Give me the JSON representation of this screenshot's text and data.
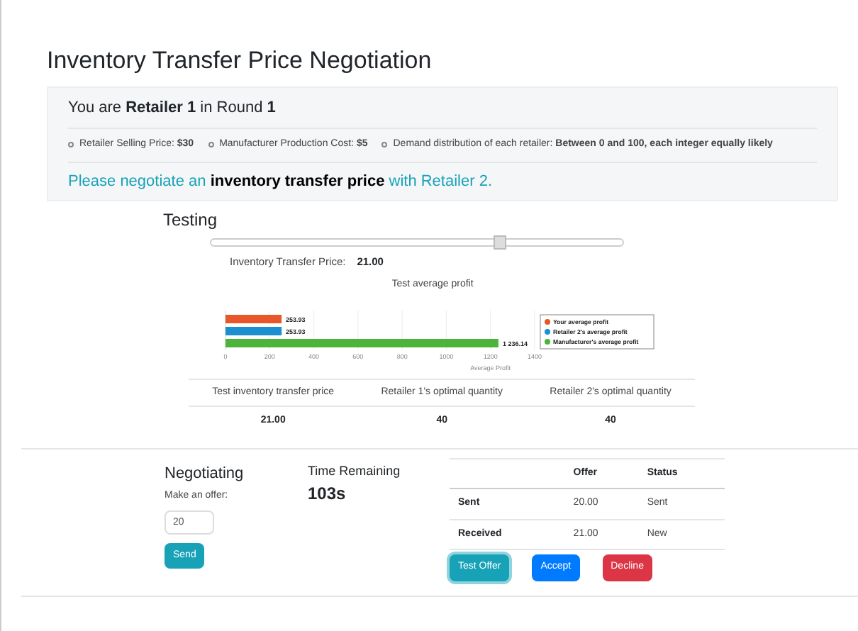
{
  "title": "Inventory Transfer Price Negotiation",
  "info": {
    "role_line": "You are **Retailer 1** in Round **1**",
    "facts": [
      "Retailer Selling Price: **$30**",
      "Manufacturer Production Cost: **$5**",
      "Demand distribution of each retailer: **Between 0 and 100, each integer equally likely**"
    ],
    "instruction": "Please negotiate an **inventory transfer price** with Retailer 2."
  },
  "testing": {
    "heading": "Testing",
    "slider": {
      "level": 0.7
    },
    "price_label": "Inventory Transfer Price:",
    "price_value": "21.00",
    "chart_data": {
      "type": "bar",
      "orientation": "horizontal",
      "title": "Test average profit",
      "xlabel": "Average Profit",
      "xlim": [
        0,
        1400
      ],
      "xticks": [
        0,
        200,
        400,
        600,
        800,
        1000,
        1200,
        1400
      ],
      "grid": true,
      "legend": "right",
      "series": [
        {
          "name": "Your average profit",
          "color": "#e8572a",
          "values": [
            254
          ]
        },
        {
          "name": "Retailer 2's average profit",
          "color": "#1b8fd0",
          "values": [
            254
          ]
        },
        {
          "name": "Manufacturer's average profit",
          "color": "#4cb43a",
          "values": [
            1236
          ]
        }
      ],
      "value_labels": [
        "253.93",
        "253.93",
        "1 236.14"
      ]
    },
    "table": {
      "columns": [
        "Test inventory transfer price",
        "Retailer 1's optimal quantity",
        "Retailer 2's optimal quantity"
      ],
      "row": [
        "21.00",
        "40",
        "40"
      ]
    }
  },
  "negotiating": {
    "heading": "Negotiating",
    "offer_label": "Make an offer:",
    "offer_value": "20",
    "send": "Send"
  },
  "timer": {
    "heading": "Time Remaining",
    "value": "103s"
  },
  "offers": {
    "columns": [
      "",
      "Offer",
      "Status"
    ],
    "rows": [
      [
        "Sent",
        "20.00",
        "Sent"
      ],
      [
        "Received",
        "21.00",
        "New"
      ]
    ]
  },
  "buttons": [
    {
      "label": "Test Offer",
      "kind": "info"
    },
    {
      "label": "Accept",
      "kind": "primary"
    },
    {
      "label": "Decline",
      "kind": "danger"
    }
  ]
}
